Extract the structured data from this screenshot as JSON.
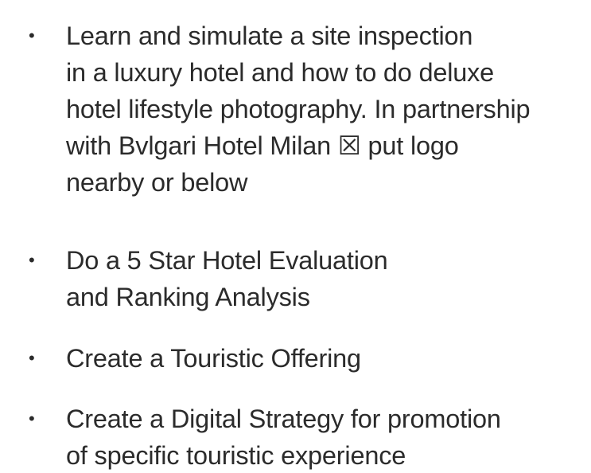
{
  "bullets": [
    {
      "lines": [
        "Learn and simulate a site inspection",
        "in a luxury hotel and how to do deluxe",
        "hotel lifestyle photography. In partnership",
        "with Bvlgari Hotel Milan ☒ put logo",
        "nearby or below"
      ]
    },
    {
      "lines": [
        "Do a 5 Star Hotel Evaluation",
        "and Ranking Analysis"
      ]
    },
    {
      "lines": [
        "Create a Touristic Offering"
      ]
    },
    {
      "lines": [
        "Create a Digital Strategy for promotion",
        "of specific touristic experience"
      ]
    }
  ],
  "bullet_glyph": "•"
}
